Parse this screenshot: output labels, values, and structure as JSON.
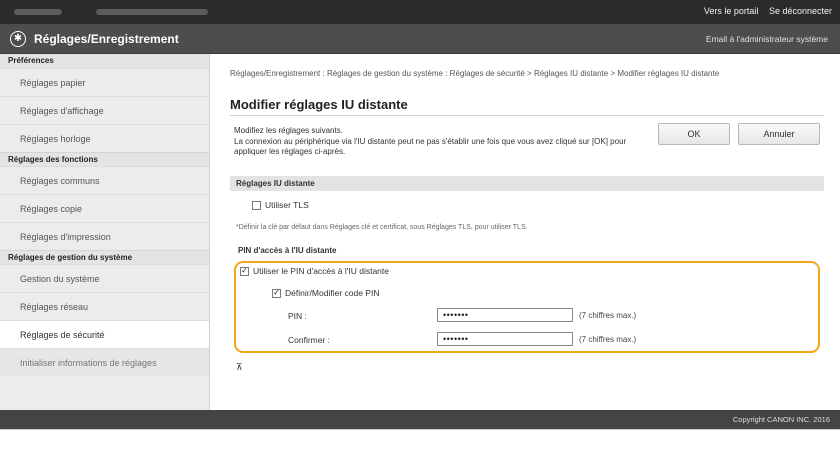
{
  "topbar": {
    "portal_link": "Vers le portail",
    "logout_link": "Se déconnecter"
  },
  "header": {
    "app_title": "Réglages/Enregistrement",
    "admin_mail_link": "Email à l'administrateur système"
  },
  "sidebar": {
    "sections": [
      {
        "title": "Préférences",
        "items": [
          "Réglages papier",
          "Réglages d'affichage",
          "Réglages horloge"
        ]
      },
      {
        "title": "Réglages des fonctions",
        "items": [
          "Réglages communs",
          "Réglages copie",
          "Réglages d'impression"
        ]
      },
      {
        "title": "Réglages de gestion du système",
        "items": [
          "Gestion du système",
          "Réglages réseau",
          "Réglages de sécurité",
          "Initialiser informations de réglages"
        ]
      }
    ],
    "active_item": "Réglages de sécurité"
  },
  "main": {
    "breadcrumb": "Réglages/Enregistrement : Réglages de gestion du système : Réglages de sécurité > Réglages IU distante > Modifier réglages IU distante",
    "title": "Modifier réglages IU distante",
    "description_line1": "Modifiez les réglages suivants.",
    "description_line2": "La connexion au périphérique via l'IU distante peut ne pas s'établir une fois que vous avez cliqué sur [OK] pour appliquer les réglages ci-après.",
    "ok_label": "OK",
    "cancel_label": "Annuler",
    "section_title": "Réglages IU distante",
    "use_tls_label": "Utiliser TLS",
    "use_tls_checked": false,
    "tls_note": "*Définir la clé par défaut dans Réglages clé et certificat, sous Réglages TLS, pour utiliser TLS.",
    "pin_heading": "PIN d'accès à l'IU distante",
    "use_pin_label": "Utiliser le PIN d'accès à l'IU distante",
    "use_pin_checked": true,
    "set_pin_label": "Définir/Modifier code PIN",
    "set_pin_checked": true,
    "pin_field_label": "PIN :",
    "pin_value": "•••••••",
    "pin_hint": "(7 chiffres max.)",
    "confirm_field_label": "Confirmer :",
    "confirm_value": "•••••••",
    "confirm_hint": "(7 chiffres max.)",
    "scroll_top_glyph": "⊼"
  },
  "footer": {
    "copyright": "Copyright CANON INC. 2016"
  },
  "colors": {
    "highlight": "#f0a818",
    "topbar": "#2b2b2b",
    "titlebar": "#4d4d4d"
  }
}
